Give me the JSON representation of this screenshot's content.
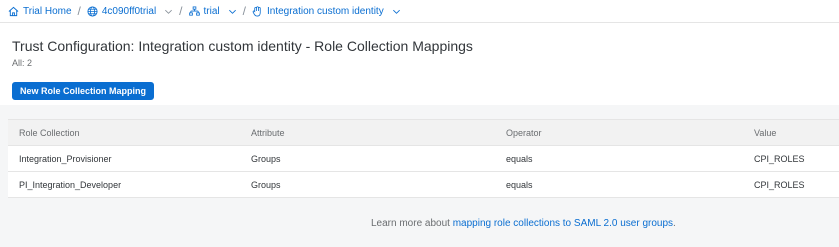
{
  "breadcrumb": {
    "items": [
      {
        "label": "Trial Home",
        "icon": "home-icon"
      },
      {
        "label": "4c090ff0trial",
        "icon": "globe-icon",
        "dropdown": true
      },
      {
        "label": "trial",
        "icon": "subaccount-icon",
        "dropdown": true
      },
      {
        "label": "Integration custom identity",
        "icon": "trust-icon",
        "dropdown": true
      }
    ],
    "separator": "/"
  },
  "header": {
    "title": "Trust Configuration: Integration custom identity - Role Collection Mappings",
    "count": "All: 2",
    "new_button": "New Role Collection Mapping"
  },
  "table": {
    "columns": [
      "Role Collection",
      "Attribute",
      "Operator",
      "Value"
    ],
    "rows": [
      [
        "Integration_Provisioner",
        "Groups",
        "equals",
        "CPI_ROLES"
      ],
      [
        "PI_Integration_Developer",
        "Groups",
        "equals",
        "CPI_ROLES"
      ]
    ]
  },
  "footer": {
    "prefix": "Learn more about ",
    "link": "mapping role collections to SAML 2.0 user groups",
    "suffix": "."
  },
  "colors": {
    "accent": "#0a6ed1",
    "text": "#32363a",
    "muted": "#6a6d70",
    "background": "#f5f6f7"
  }
}
